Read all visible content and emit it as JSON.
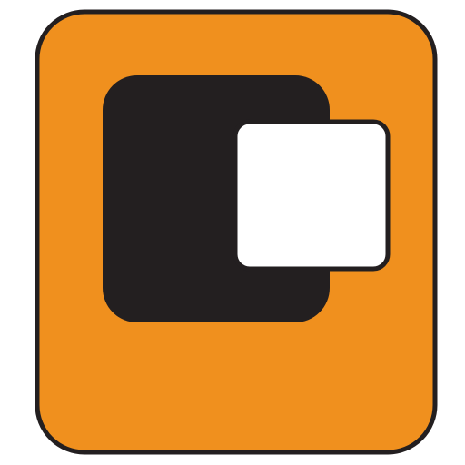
{
  "icon": {
    "name": "app-logo-icon",
    "colors": {
      "background": "#ffffff",
      "tile_fill": "#f0901e",
      "outline": "#231f20",
      "dark_square": "#231f20",
      "light_square": "#ffffff"
    }
  }
}
